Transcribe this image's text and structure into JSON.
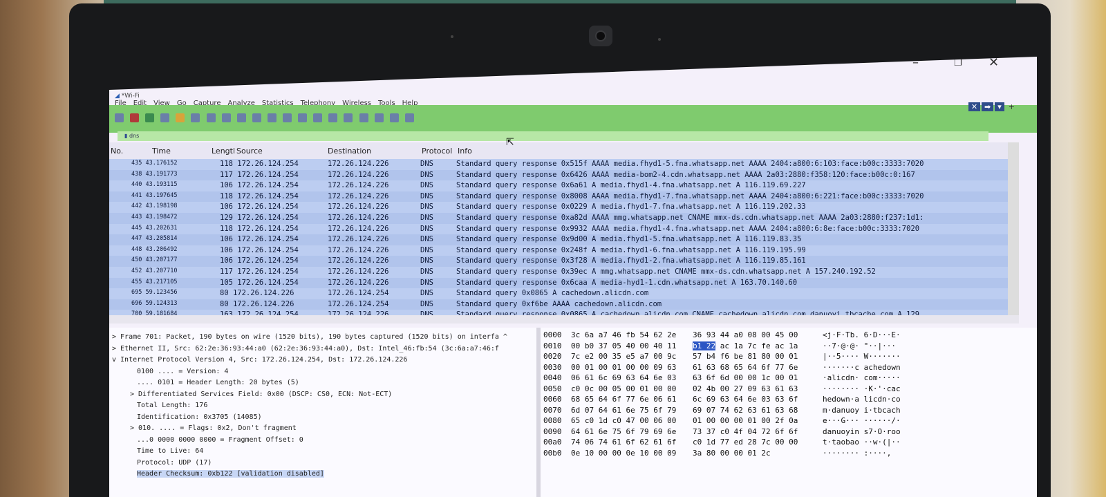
{
  "window": {
    "title": "*Wi-Fi"
  },
  "menu": [
    "File",
    "Edit",
    "View",
    "Go",
    "Capture",
    "Analyze",
    "Statistics",
    "Telephony",
    "Wireless",
    "Tools",
    "Help"
  ],
  "filter": {
    "value": "dns"
  },
  "packet_list": {
    "columns": {
      "no": "No.",
      "time": "Time",
      "length": "Lengtl",
      "source": "Source",
      "destination": "Destination",
      "protocol": "Protocol",
      "info": "Info"
    },
    "rows": [
      {
        "no_time": "435 43.176152",
        "len_src": "118 172.26.124.254",
        "dst": "172.26.124.226",
        "proto": "DNS",
        "info": "Standard query response 0x515f AAAA media.fhyd1-5.fna.whatsapp.net AAAA 2404:a800:6:103:face:b00c:3333:7020"
      },
      {
        "no_time": "438 43.191773",
        "len_src": "117 172.26.124.254",
        "dst": "172.26.124.226",
        "proto": "DNS",
        "info": "Standard query response 0x6426 AAAA media-bom2-4.cdn.whatsapp.net AAAA 2a03:2880:f358:120:face:b00c:0:167"
      },
      {
        "no_time": "440 43.193115",
        "len_src": "106 172.26.124.254",
        "dst": "172.26.124.226",
        "proto": "DNS",
        "info": "Standard query response 0x6a61 A media.fhyd1-4.fna.whatsapp.net A 116.119.69.227"
      },
      {
        "no_time": "441 43.197645",
        "len_src": "118 172.26.124.254",
        "dst": "172.26.124.226",
        "proto": "DNS",
        "info": "Standard query response 0x8008 AAAA media.fhyd1-7.fna.whatsapp.net AAAA 2404:a800:6:221:face:b00c:3333:7020"
      },
      {
        "no_time": "442 43.198198",
        "len_src": "106 172.26.124.254",
        "dst": "172.26.124.226",
        "proto": "DNS",
        "info": "Standard query response 0x0229 A media.fhyd1-7.fna.whatsapp.net A 116.119.202.33"
      },
      {
        "no_time": "443 43.198472",
        "len_src": "129 172.26.124.254",
        "dst": "172.26.124.226",
        "proto": "DNS",
        "info": "Standard query response 0xa82d AAAA mmg.whatsapp.net CNAME mmx-ds.cdn.whatsapp.net AAAA 2a03:2880:f237:1d1:"
      },
      {
        "no_time": "445 43.202631",
        "len_src": "118 172.26.124.254",
        "dst": "172.26.124.226",
        "proto": "DNS",
        "info": "Standard query response 0x9932 AAAA media.fhyd1-4.fna.whatsapp.net AAAA 2404:a800:6:8e:face:b00c:3333:7020"
      },
      {
        "no_time": "447 43.205814",
        "len_src": "106 172.26.124.254",
        "dst": "172.26.124.226",
        "proto": "DNS",
        "info": "Standard query response 0x9d00 A media.fhyd1-5.fna.whatsapp.net A 116.119.83.35"
      },
      {
        "no_time": "448 43.206492",
        "len_src": "106 172.26.124.254",
        "dst": "172.26.124.226",
        "proto": "DNS",
        "info": "Standard query response 0x248f A media.fhyd1-6.fna.whatsapp.net A 116.119.195.99"
      },
      {
        "no_time": "450 43.207177",
        "len_src": "106 172.26.124.254",
        "dst": "172.26.124.226",
        "proto": "DNS",
        "info": "Standard query response 0x3f28 A media.fhyd1-2.fna.whatsapp.net A 116.119.85.161"
      },
      {
        "no_time": "452 43.207710",
        "len_src": "117 172.26.124.254",
        "dst": "172.26.124.226",
        "proto": "DNS",
        "info": "Standard query response 0x39ec A mmg.whatsapp.net CNAME mmx-ds.cdn.whatsapp.net A 157.240.192.52"
      },
      {
        "no_time": "455 43.217105",
        "len_src": "105 172.26.124.254",
        "dst": "172.26.124.226",
        "proto": "DNS",
        "info": "Standard query response 0x6caa A media-hyd1-1.cdn.whatsapp.net A 163.70.140.60"
      },
      {
        "no_time": "695 59.123456",
        "len_src": "80 172.26.124.226",
        "dst": "172.26.124.254",
        "proto": "DNS",
        "info": "Standard query 0x0865 A cachedown.alicdn.com"
      },
      {
        "no_time": "696 59.124313",
        "len_src": "80 172.26.124.226",
        "dst": "172.26.124.254",
        "proto": "DNS",
        "info": "Standard query 0xf6be AAAA cachedown.alicdn.com"
      },
      {
        "no_time": "700 59.181684",
        "len_src": "163 172.26.124.254",
        "dst": "172.26.124.226",
        "proto": "DNS",
        "info": "Standard query response 0x0865 A cachedown.alicdn.com CNAME cachedown.alicdn.com.danuoyi.tbcache.com A 129."
      }
    ]
  },
  "details": [
    "> Frame 701: Packet, 190 bytes on wire (1520 bits), 190 bytes captured (1520 bits) on interfa ^",
    "> Ethernet II, Src: 62:2e:36:93:44:a0 (62:2e:36:93:44:a0), Dst: Intel_46:fb:54 (3c:6a:a7:46:f",
    "v Internet Protocol Version 4, Src: 172.26.124.254, Dst: 172.26.124.226",
    "0100 .... = Version: 4",
    ".... 0101 = Header Length: 20 bytes (5)",
    "> Differentiated Services Field: 0x00 (DSCP: CS0, ECN: Not-ECT)",
    "Total Length: 176",
    "Identification: 0x3705 (14085)",
    "> 010. .... = Flags: 0x2, Don't fragment",
    "...0 0000 0000 0000 = Fragment Offset: 0",
    "Time to Live: 64",
    "Protocol: UDP (17)",
    "Header Checksum: 0xb122 [validation disabled]"
  ],
  "hex": [
    {
      "off": "0000",
      "b1": "3c 6a a7 46 fb 54 62 2e",
      "b2": "36 93 44 a0 08 00 45 00",
      "ascii": "<j·F·Tb. 6·D···E·"
    },
    {
      "off": "0010",
      "b1": "00 b0 37 05 40 00 40 11",
      "b2pre": "",
      "hl": "b1 22",
      "b2": " ac 1a 7c fe ac 1a",
      "ascii": "··7·@·@· \"··|···"
    },
    {
      "off": "0020",
      "b1": "7c e2 00 35 e5 a7 00 9c",
      "b2": "57 b4 f6 be 81 80 00 01",
      "ascii": "|··5···· W·······"
    },
    {
      "off": "0030",
      "b1": "00 01 00 01 00 00 09 63",
      "b2": "61 63 68 65 64 6f 77 6e",
      "ascii": "·······c achedown"
    },
    {
      "off": "0040",
      "b1": "06 61 6c 69 63 64 6e 03",
      "b2": "63 6f 6d 00 00 1c 00 01",
      "ascii": "·alicdn· com·····"
    },
    {
      "off": "0050",
      "b1": "c0 0c 00 05 00 01 00 00",
      "b2": "02 4b 00 27 09 63 61 63",
      "ascii": "········ ·K·'·cac"
    },
    {
      "off": "0060",
      "b1": "68 65 64 6f 77 6e 06 61",
      "b2": "6c 69 63 64 6e 03 63 6f",
      "ascii": "hedown·a licdn·co"
    },
    {
      "off": "0070",
      "b1": "6d 07 64 61 6e 75 6f 79",
      "b2": "69 07 74 62 63 61 63 68",
      "ascii": "m·danuoy i·tbcach"
    },
    {
      "off": "0080",
      "b1": "65 c0 1d c0 47 00 06 00",
      "b2": "01 00 00 00 01 00 2f 0a",
      "ascii": "e···G··· ······/·"
    },
    {
      "off": "0090",
      "b1": "64 61 6e 75 6f 79 69 6e",
      "b2": "73 37 c0 4f 04 72 6f 6f",
      "ascii": "danuoyin s7·O·roo"
    },
    {
      "off": "00a0",
      "b1": "74 06 74 61 6f 62 61 6f",
      "b2": "c0 1d 77 ed 28 7c 00 00",
      "ascii": "t·taobao ··w·(|··"
    },
    {
      "off": "00b0",
      "b1": "0e 10 00 00 0e 10 00 09",
      "b2": "3a 80 00 00 01 2c",
      "ascii": "········ :····,"
    }
  ],
  "colors": {
    "filter_green": "#7fcb6e",
    "row_blue": "#b6c7ee",
    "highlight": "#2c56c4"
  }
}
